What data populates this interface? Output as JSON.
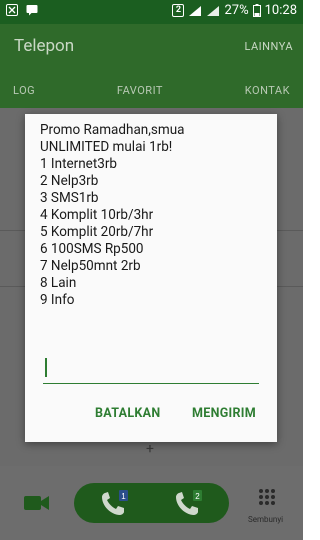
{
  "status_bar": {
    "sim_indicator": "2",
    "battery": "27%",
    "time": "10:28"
  },
  "app": {
    "title": "Telepon",
    "more_label": "LAINNYA",
    "tabs": [
      "LOG",
      "FAVORIT",
      "KONTAK"
    ],
    "dialpad_label": "Sembunyi",
    "sim1_badge": "1",
    "sim2_badge": "2"
  },
  "dialog": {
    "message_lines": [
      "Promo Ramadhan,smua",
      "UNLIMITED mulai 1rb!",
      "1 Internet3rb",
      "2 Nelp3rb",
      "3 SMS1rb",
      "4 Komplit 10rb/3hr",
      "5 Komplit 20rb/7hr",
      "6 100SMS Rp500",
      "7 Nelp50mnt 2rb",
      "8 Lain",
      "9 Info"
    ],
    "input_value": "",
    "cancel_label": "BATALKAN",
    "send_label": "MENGIRIM"
  },
  "colors": {
    "accent": "#2e7d32",
    "toolbar": "#2f6a2a",
    "scrim": "#6b6b6b"
  }
}
